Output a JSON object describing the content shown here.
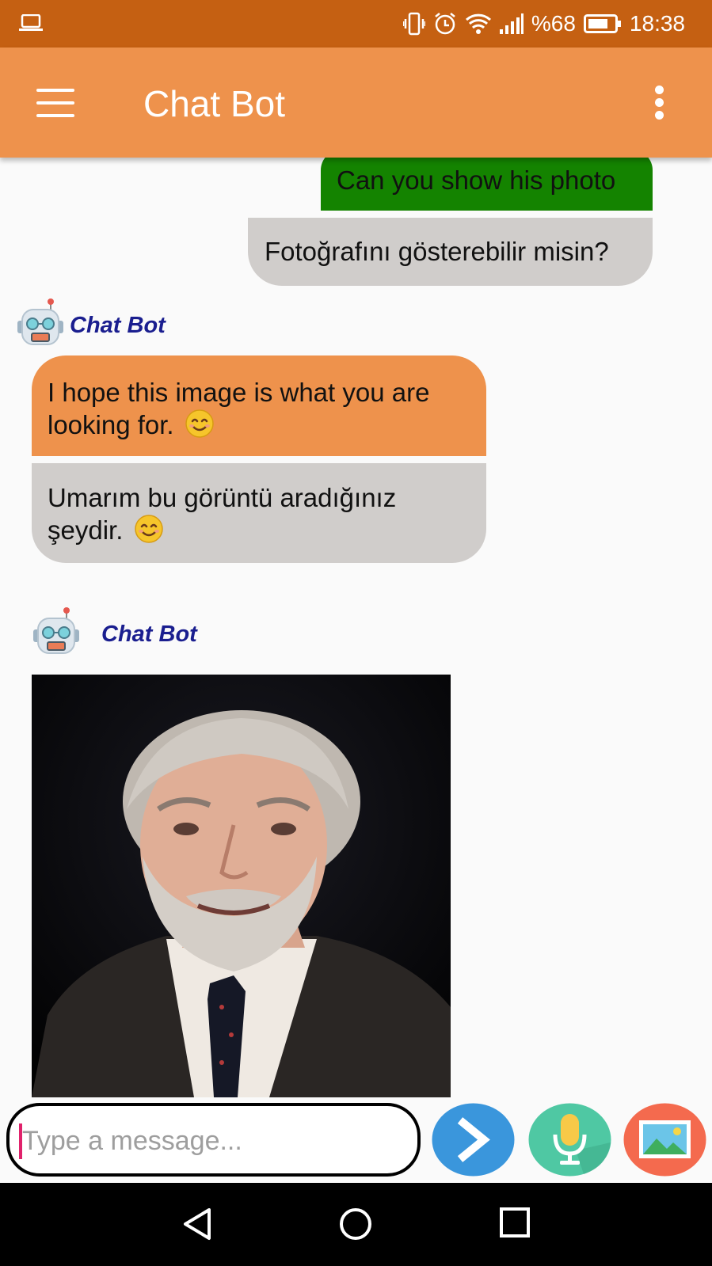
{
  "status_bar": {
    "battery": "%68",
    "time": "18:38",
    "icons": [
      "laptop-icon",
      "vibrate-icon",
      "alarm-icon",
      "wifi-icon",
      "signal-icon",
      "battery-icon"
    ]
  },
  "app_bar": {
    "title": "Chat Bot",
    "icons": [
      "hamburger-menu-icon",
      "overflow-menu-icon"
    ]
  },
  "messages": {
    "user": {
      "english": "Can you show his photo",
      "translation": "Fotoğrafını gösterebilir misin?"
    },
    "bot_text": {
      "sender": "Chat Bot",
      "english": "I hope this image is what you are looking for.",
      "translation": "Umarım bu görüntü aradığınız şeydir."
    },
    "bot_image": {
      "sender": "Chat Bot"
    }
  },
  "composer": {
    "placeholder": "Type a message...",
    "value": ""
  },
  "action_buttons": [
    "send-icon",
    "microphone-icon",
    "image-gallery-icon"
  ],
  "colors": {
    "status_bar": "#c56012",
    "app_bar": "#ee924c",
    "user_bubble": "#148300",
    "bot_bubble": "#ee924c",
    "translation_bubble": "#d0cdcb",
    "bot_name": "#1a1e8f",
    "send_button": "#3a96dc",
    "mic_button": "#4fc8a3",
    "image_button": "#f46a4e"
  }
}
